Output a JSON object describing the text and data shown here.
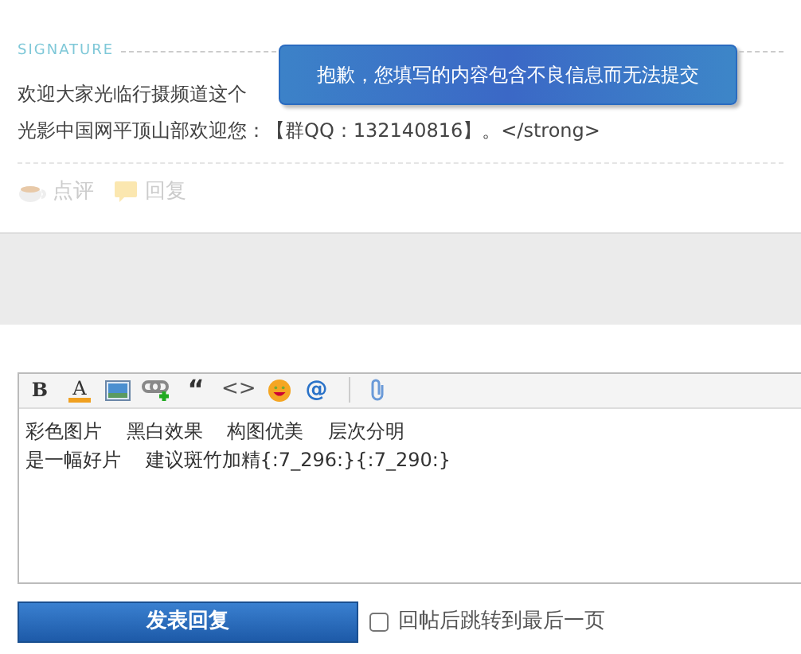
{
  "signature": {
    "label": "SIGNATURE",
    "lines": [
      "欢迎大家光临行摄频道这个",
      "光影中国网平顶山部欢迎您：【群QQ：132140816】。</strong>"
    ]
  },
  "actions": [
    {
      "kind": "comment",
      "label": "点评"
    },
    {
      "kind": "reply",
      "label": "回复"
    }
  ],
  "toast": {
    "message": "抱歉，您填写的内容包含不良信息而无法提交"
  },
  "toolbar": [
    {
      "kind": "bold",
      "label": "B"
    },
    {
      "kind": "color",
      "label": "A"
    },
    {
      "kind": "image"
    },
    {
      "kind": "link"
    },
    {
      "kind": "quote",
      "label": "“"
    },
    {
      "kind": "code",
      "label": "<>"
    },
    {
      "kind": "emoji"
    },
    {
      "kind": "at",
      "label": "@"
    },
    {
      "kind": "separator"
    },
    {
      "kind": "attach"
    }
  ],
  "editor": {
    "lines": [
      "彩色图片    黑白效果    构图优美    层次分明",
      "是一幅好片    建议斑竹加精{:7_296:}{:7_290:}"
    ]
  },
  "submit": {
    "label": "发表回复"
  },
  "jump_option": {
    "label": "回帖后跳转到最后一页",
    "checked": false
  }
}
